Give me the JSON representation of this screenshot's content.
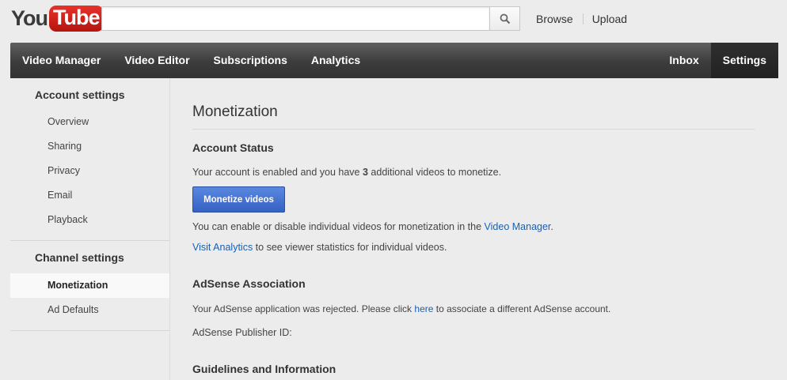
{
  "logo": {
    "you": "You",
    "tube": "Tube"
  },
  "search": {
    "placeholder": "",
    "value": ""
  },
  "top_links": {
    "browse": "Browse",
    "upload": "Upload"
  },
  "nav": {
    "left": [
      "Video Manager",
      "Video Editor",
      "Subscriptions",
      "Analytics"
    ],
    "inbox": "Inbox",
    "settings": "Settings"
  },
  "sidebar": {
    "account_heading": "Account settings",
    "account_items": [
      "Overview",
      "Sharing",
      "Privacy",
      "Email",
      "Playback"
    ],
    "channel_heading": "Channel settings",
    "channel_items": [
      "Monetization",
      "Ad Defaults"
    ]
  },
  "main": {
    "title": "Monetization",
    "account_status": {
      "heading": "Account Status",
      "line_prefix": "Your account is enabled and you have ",
      "count": "3",
      "line_suffix": " additional videos to monetize.",
      "button": "Monetize videos",
      "enable_text": "You can enable or disable individual videos for monetization in the ",
      "enable_link": "Video Manager",
      "enable_end": ".",
      "analytics_link": "Visit Analytics",
      "analytics_text": " to see viewer statistics for individual videos."
    },
    "adsense": {
      "heading": "AdSense Association",
      "rejected_text": "Your AdSense application was rejected. Please click ",
      "here_link": "here",
      "rejected_end": " to associate a different AdSense account.",
      "publisher_label": "AdSense Publisher ID:"
    },
    "guidelines": {
      "heading": "Guidelines and Information"
    }
  }
}
